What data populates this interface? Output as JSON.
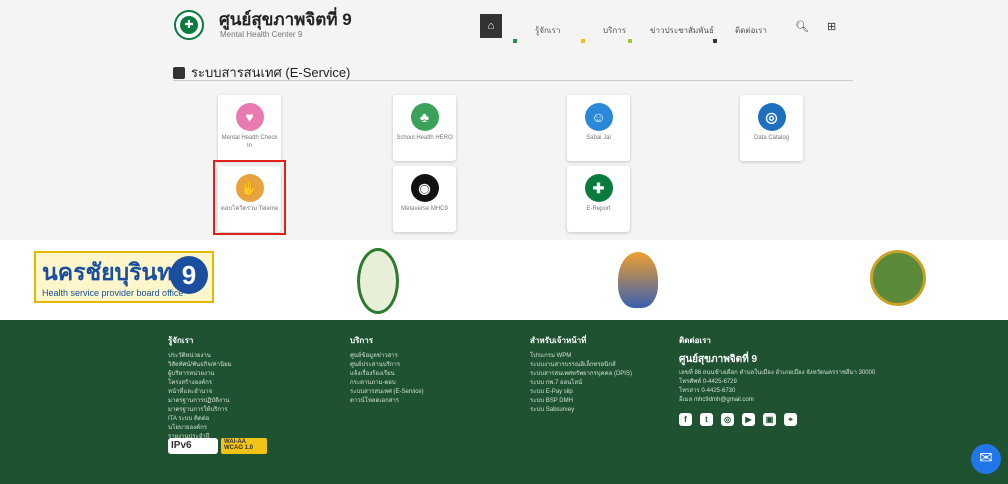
{
  "header": {
    "title": "ศูนย์สุขภาพจิตที่ 9",
    "subtitle": "Mental Health Center 9",
    "nav": [
      {
        "label": "รู้จักเรา",
        "dot": "#2e8b57"
      },
      {
        "label": "บริการ",
        "dot": "#f1c40f"
      },
      {
        "label": "ข่าวประชาสัมพันธ์",
        "dot": "#9acd32"
      },
      {
        "label": "ติดต่อเรา",
        "dot": "#333333"
      }
    ]
  },
  "section": {
    "title": "ระบบสารสนเทศ (E-Service)"
  },
  "cards": [
    {
      "label": "Mental Health Check In",
      "color": "#e97ab0",
      "glyph": "♥"
    },
    {
      "label": "School Health HERO",
      "color": "#3aa25a",
      "glyph": "♣"
    },
    {
      "label": "Sabai Jai",
      "color": "#2b88d8",
      "glyph": "☺"
    },
    {
      "label": "Data Catalog",
      "color": "#1e6fc0",
      "glyph": "◎"
    },
    {
      "label": "ตอบโควิดร่วม Teleme",
      "color": "#e8a33d",
      "glyph": "✋"
    },
    {
      "label": "Metaverse MHC9",
      "color": "#111111",
      "glyph": "◉"
    },
    {
      "label": "E-Report",
      "color": "#0b7a3e",
      "glyph": "✚"
    }
  ],
  "partners": {
    "board_title": "นครชัยบุรินทร์",
    "board_sub": "Health service provider board office",
    "board_num": "9"
  },
  "footer": {
    "c1": {
      "title": "รู้จักเรา",
      "items": [
        "ประวัติหน่วยงาน",
        "วิสัยทัศน์/พันธกิจ/ค่านิยม",
        "ผู้บริหารหน่วยงาน",
        "โครงสร้างองค์กร",
        "หน้าที่และอำนาจ",
        "มาตรฐานการปฏิบัติงาน",
        "มาตรฐานการให้บริการ",
        "ITA ระบบ ติดต่อ",
        "นโยบายองค์กร",
        "รายงานประจำปี"
      ]
    },
    "c2": {
      "title": "บริการ",
      "items": [
        "ศูนย์ข้อมูลข่าวสาร",
        "ศูนย์ประสานบริการ",
        "แจ้งเรื่องร้องเรียน",
        "กระดานถาม-ตอบ",
        "ระบบสารสนเทศ (E-Service)",
        "ดาวน์โหลดเอกสาร"
      ]
    },
    "c3": {
      "title": "สำหรับเจ้าหน้าที่",
      "items": [
        "โปรแกรม WPM",
        "ระบบงานสารบรรณอิเล็กทรอนิกส์",
        "ระบบสารสนเทศทรัพยากรบุคคล (DPIS)",
        "ระบบ กพ.7 ออนไลน์",
        "ระบบ E-Pay slip",
        "ระบบ BSP DMH",
        "ระบบ Sabsurvey"
      ]
    },
    "c4": {
      "title": "ติดต่อเรา",
      "name": "ศูนย์สุขภาพจิตที่ 9",
      "items": [
        "เลขที่ 86 ถนนช้างเผือก ตำบลในเมือง อำเภอเมือง จังหวัดนครราชสีมา 30000",
        "โทรศัพท์ 0-4425-6729",
        "โทรสาร 0-4425-6730",
        "อีเมล mhc9dmh@gmail.com"
      ]
    },
    "social": [
      "f",
      "t",
      "◎",
      "▶",
      "▣",
      "⌖"
    ],
    "badge_ipv6": "IPv6",
    "badge_wcag": "WAI-AA WCAG 1.0"
  }
}
